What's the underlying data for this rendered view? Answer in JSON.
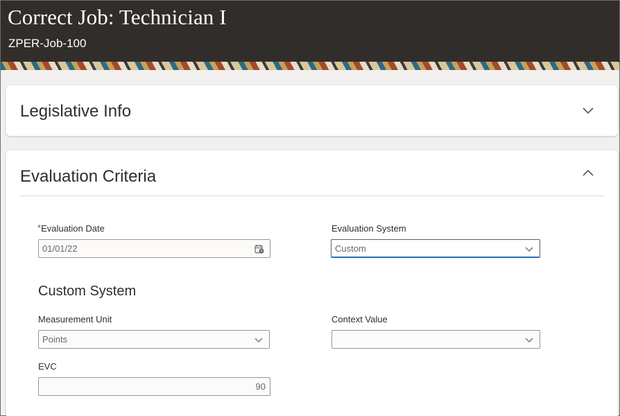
{
  "header": {
    "title": "Correct Job: Technician I",
    "subtitle": "ZPER-Job-100"
  },
  "sections": {
    "legislative": {
      "title": "Legislative Info",
      "expanded": false
    },
    "evaluation": {
      "title": "Evaluation Criteria",
      "expanded": true
    }
  },
  "fields": {
    "evaluation_date": {
      "label": "Evaluation Date",
      "required_mark": "*",
      "value": "01/01/22"
    },
    "evaluation_system": {
      "label": "Evaluation System",
      "value": "Custom"
    },
    "custom_system_heading": "Custom System",
    "measurement_unit": {
      "label": "Measurement Unit",
      "value": "Points"
    },
    "context_value": {
      "label": "Context Value",
      "value": ""
    },
    "evc": {
      "label": "EVC",
      "value": "90"
    }
  },
  "colors": {
    "header_bg": "#312d2a",
    "accent": "#2b70c7",
    "text": "#312d2a"
  },
  "icons": {
    "collapse": "chevron-down-icon",
    "expand": "chevron-up-icon",
    "calendar": "calendar-icon",
    "dropdown": "chevron-down-icon"
  }
}
